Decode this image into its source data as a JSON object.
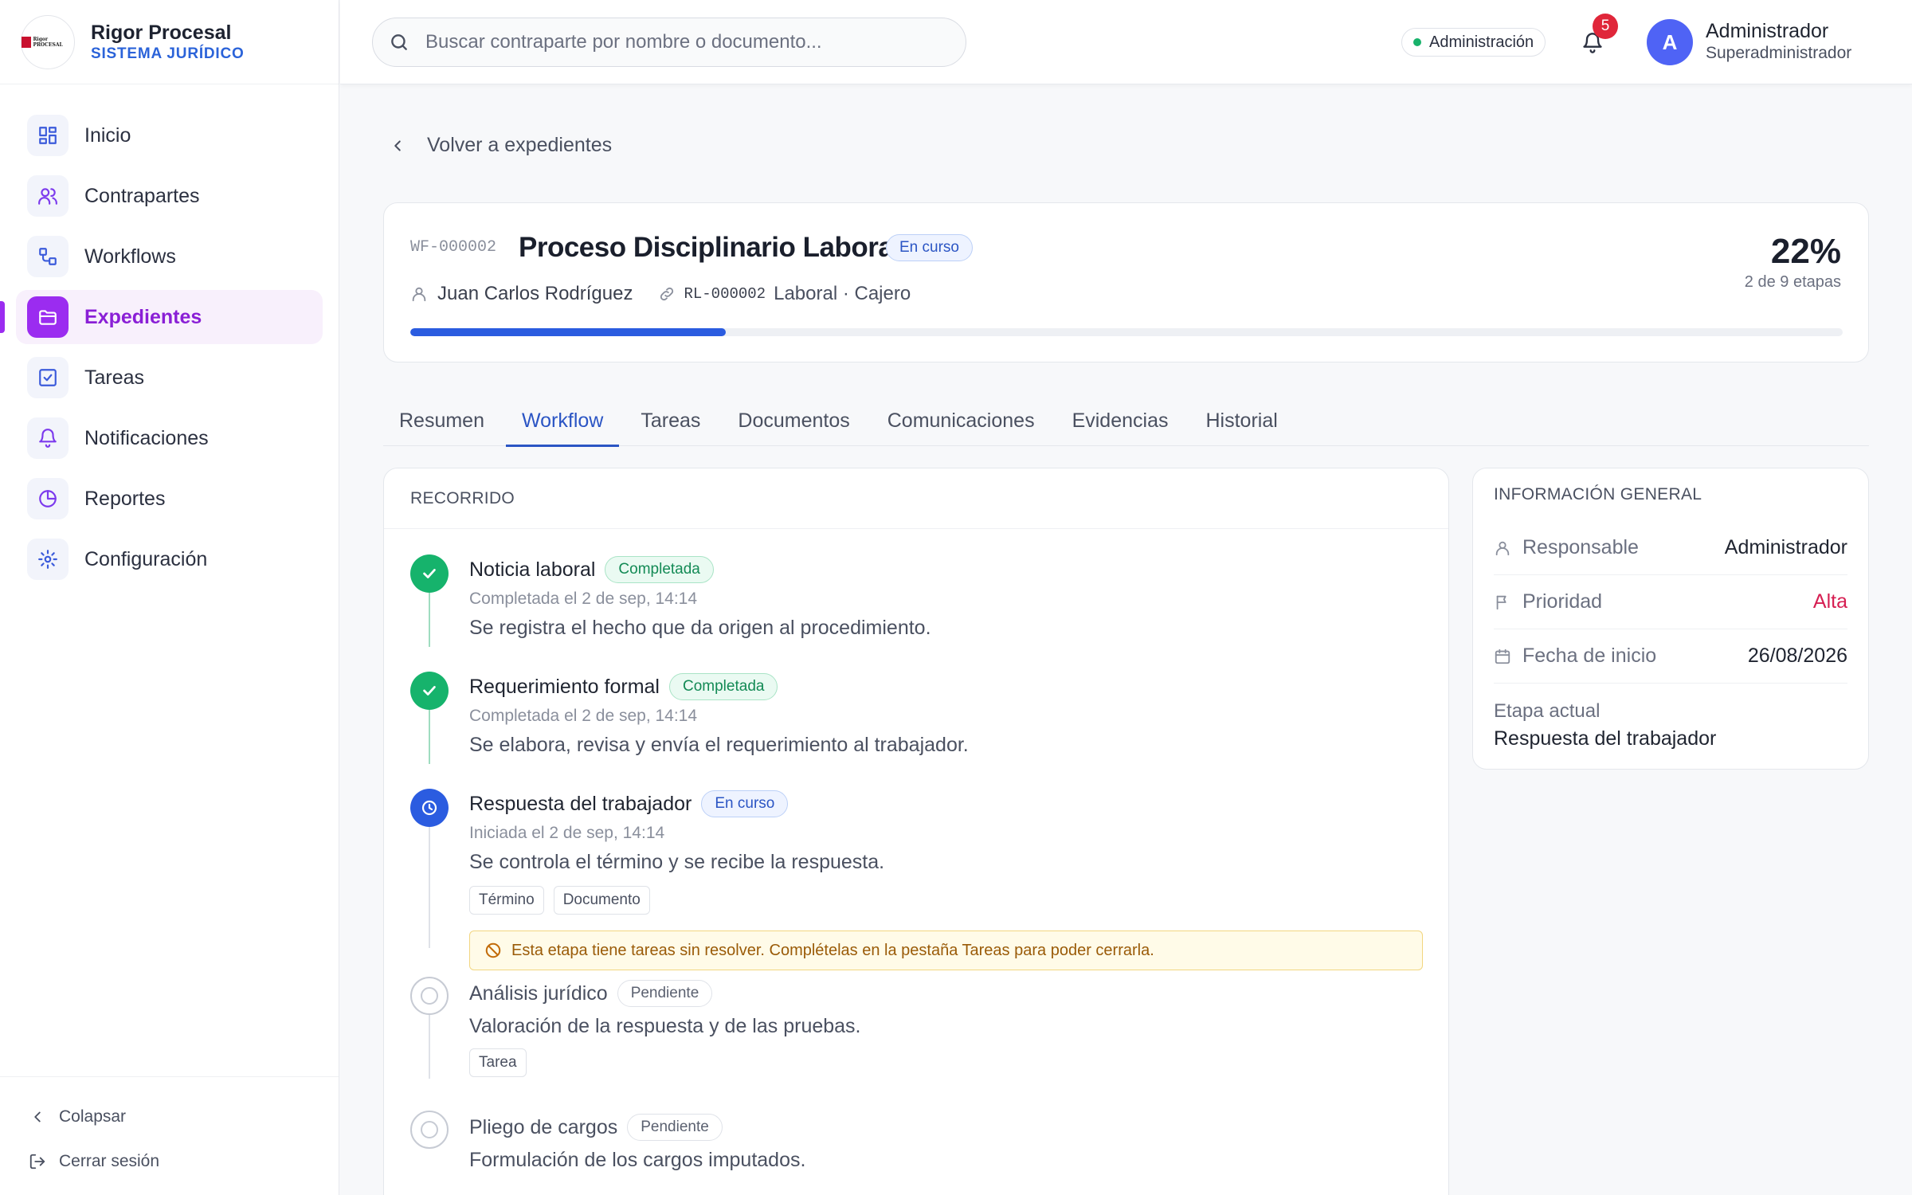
{
  "brand": {
    "name": "Rigor Procesal",
    "subtitle": "SISTEMA JURÍDICO",
    "logo_text": "Rigor PROCESAL"
  },
  "sidebar": {
    "items": [
      {
        "label": "Inicio",
        "icon": "grid-icon"
      },
      {
        "label": "Contrapartes",
        "icon": "users-icon"
      },
      {
        "label": "Workflows",
        "icon": "workflow-icon"
      },
      {
        "label": "Expedientes",
        "icon": "folder-icon",
        "active": true
      },
      {
        "label": "Tareas",
        "icon": "checkbox-icon"
      },
      {
        "label": "Notificaciones",
        "icon": "bell-icon"
      },
      {
        "label": "Reportes",
        "icon": "pie-chart-icon"
      },
      {
        "label": "Configuración",
        "icon": "gear-icon"
      }
    ],
    "collapse_label": "Colapsar",
    "logout_label": "Cerrar sesión"
  },
  "topbar": {
    "search_placeholder": "Buscar contraparte por nombre o documento...",
    "environment": "Administración",
    "notification_count": "5",
    "user_initial": "A",
    "user_name": "Administrador",
    "user_role": "Superadministrador"
  },
  "back_label": "Volver a expedientes",
  "case": {
    "code": "WF-000002",
    "title": "Proceso Disciplinario Laboral",
    "status": "En curso",
    "person": "Juan Carlos Rodríguez",
    "ref": "RL-000002",
    "category": "Laboral · Cajero",
    "progress_percent": "22%",
    "progress_value": 0.22,
    "stages": "2 de 9 etapas"
  },
  "tabs": [
    "Resumen",
    "Workflow",
    "Tareas",
    "Documentos",
    "Comunicaciones",
    "Evidencias",
    "Historial"
  ],
  "active_tab": "Workflow",
  "route": {
    "title": "RECORRIDO",
    "steps": [
      {
        "name": "Noticia laboral",
        "status": "Completada",
        "when": "Completada el 2 de sep, 14:14",
        "desc": "Se registra el hecho que da origen al procedimiento."
      },
      {
        "name": "Requerimiento formal",
        "status": "Completada",
        "when": "Completada el 2 de sep, 14:14",
        "desc": "Se elabora, revisa y envía el requerimiento al trabajador."
      },
      {
        "name": "Respuesta del trabajador",
        "status": "En curso",
        "when": "Iniciada el 2 de sep, 14:14",
        "desc": "Se controla el término y se recibe la respuesta.",
        "chips": [
          "Término",
          "Documento"
        ],
        "warning": "Esta etapa tiene tareas sin resolver. Complételas en la pestaña Tareas para poder cerrarla."
      },
      {
        "name": "Análisis jurídico",
        "status": "Pendiente",
        "desc": "Valoración de la respuesta y de las pruebas.",
        "chips": [
          "Tarea"
        ]
      },
      {
        "name": "Pliego de cargos",
        "status": "Pendiente",
        "desc": "Formulación de los cargos imputados."
      }
    ]
  },
  "info": {
    "title": "INFORMACIÓN GENERAL",
    "responsable_label": "Responsable",
    "responsable_value": "Administrador",
    "prioridad_label": "Prioridad",
    "prioridad_value": "Alta",
    "fecha_label": "Fecha de inicio",
    "fecha_value": "26/08/2026",
    "etapa_label": "Etapa actual",
    "etapa_value": "Respuesta del trabajador"
  },
  "colors": {
    "accent": "#2b5ce0",
    "active_nav": "#9b2cf0",
    "done": "#16b36c",
    "priority_high": "#d61f52"
  }
}
